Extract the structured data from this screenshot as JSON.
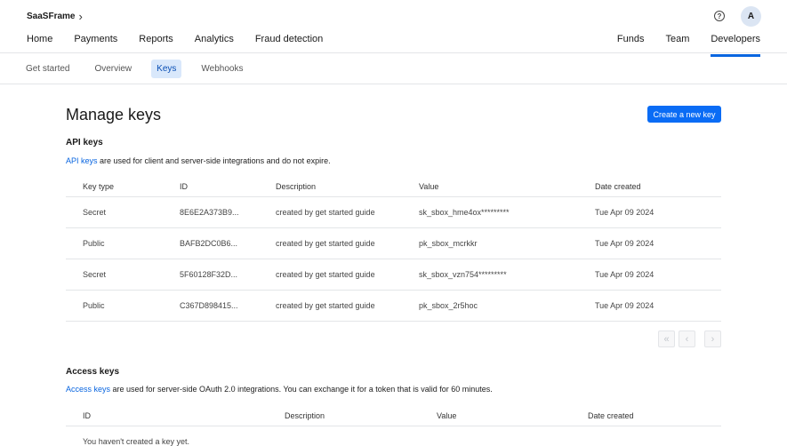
{
  "brand": {
    "name": "SaaSFrame"
  },
  "header": {
    "help_icon": "question-circle-icon",
    "avatar_initial": "A"
  },
  "nav_left": [
    "Home",
    "Payments",
    "Reports",
    "Analytics",
    "Fraud detection"
  ],
  "nav_right": [
    "Funds",
    "Team",
    "Developers"
  ],
  "subnav": [
    "Get started",
    "Overview",
    "Keys",
    "Webhooks"
  ],
  "page": {
    "title": "Manage keys",
    "create_button": "Create a new key"
  },
  "api_keys": {
    "heading": "API keys",
    "link_text": "API keys",
    "description_rest": " are used for client and server-side integrations and do not expire.",
    "columns": [
      "Key type",
      "ID",
      "Description",
      "Value",
      "Date created"
    ],
    "rows": [
      [
        "Secret",
        "8E6E2A373B9...",
        "created by get started guide",
        "sk_sbox_hme4ox*********",
        "Tue Apr 09 2024"
      ],
      [
        "Public",
        "BAFB2DC0B6...",
        "created by get started guide",
        "pk_sbox_mcrkkr",
        "Tue Apr 09 2024"
      ],
      [
        "Secret",
        "5F60128F32D...",
        "created by get started guide",
        "sk_sbox_vzn754*********",
        "Tue Apr 09 2024"
      ],
      [
        "Public",
        "C367D898415...",
        "created by get started guide",
        "pk_sbox_2r5hoc",
        "Tue Apr 09 2024"
      ]
    ]
  },
  "pagination": {
    "first": "«",
    "prev": "‹",
    "next": "›"
  },
  "access_keys": {
    "heading": "Access keys",
    "link_text": "Access keys",
    "description_rest": " are used for server-side OAuth 2.0 integrations. You can exchange it for a token that is valid for 60 minutes.",
    "columns": [
      "ID",
      "Description",
      "Value",
      "Date created"
    ],
    "empty_text": "You haven't created a key yet."
  },
  "colors": {
    "accent": "#0a6cf5",
    "active_tab_bg": "#d9e8fb"
  }
}
